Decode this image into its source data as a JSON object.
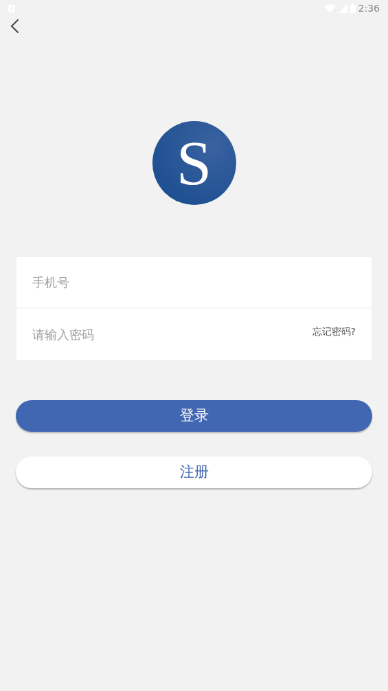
{
  "status_bar": {
    "time": "2:36"
  },
  "logo": {
    "letter": "S"
  },
  "form": {
    "phone": {
      "placeholder": "手机号"
    },
    "password": {
      "placeholder": "请输入密码"
    },
    "forgot_link": "忘记密码?"
  },
  "buttons": [
    {
      "kind": "primary",
      "label": "登录"
    },
    {
      "kind": "secondary",
      "label": "注册"
    }
  ]
}
